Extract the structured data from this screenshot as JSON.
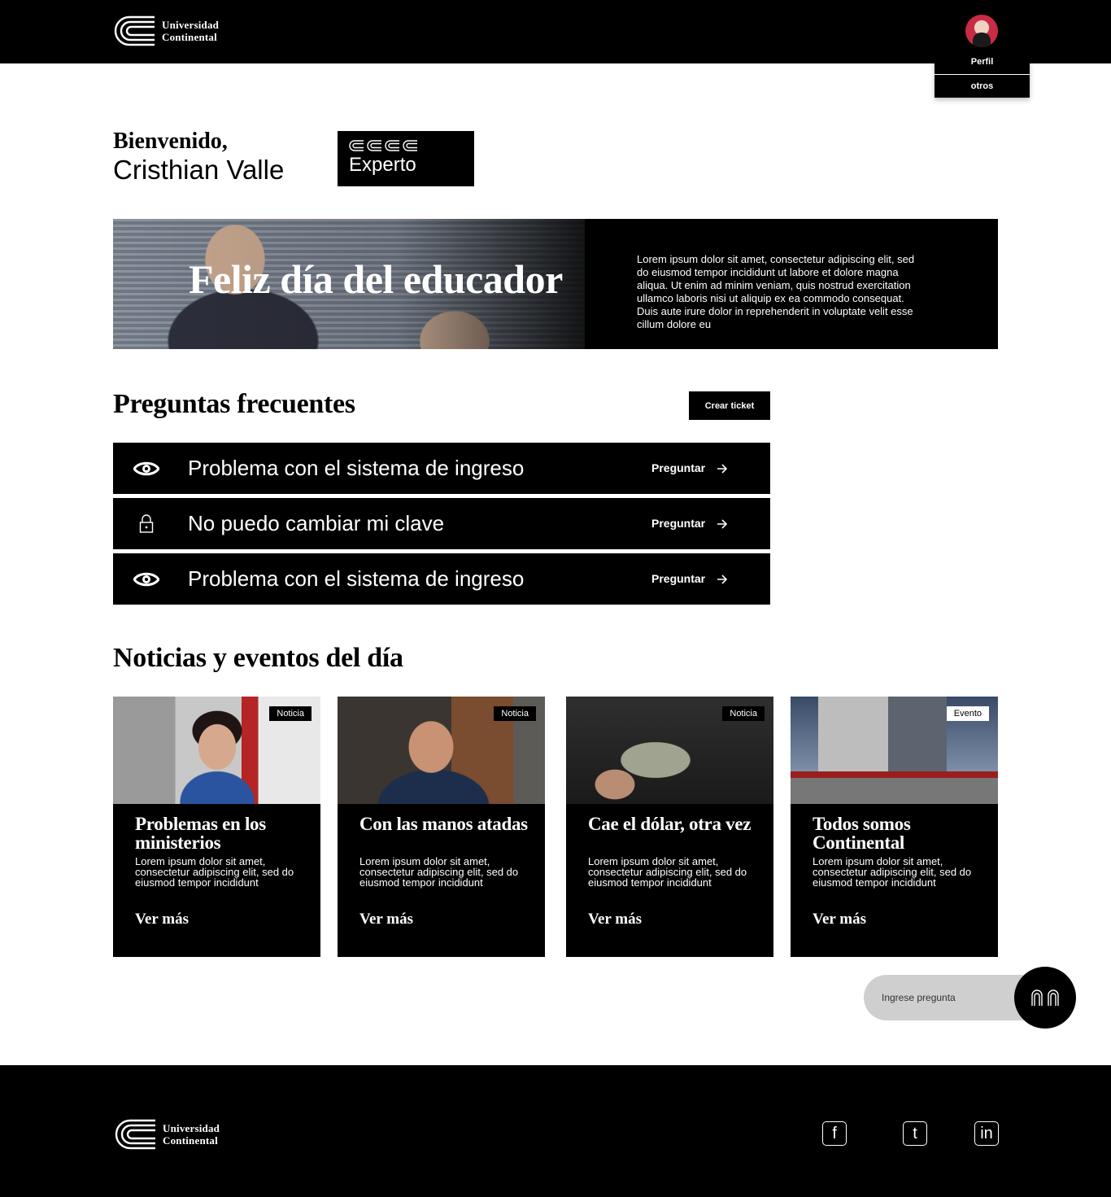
{
  "header": {
    "logo_line1": "Universidad",
    "logo_line2": "Continental",
    "profile_label": "Perfil",
    "profile_other": "otros"
  },
  "welcome": {
    "greeting": "Bienvenido,",
    "name": "Cristhian Valle",
    "level": "Experto"
  },
  "banner": {
    "title": "Feliz día del educador",
    "text": "Lorem ipsum dolor sit amet, consectetur adipiscing elit, sed do eiusmod tempor incididunt ut labore et dolore magna aliqua. Ut enim ad minim veniam, quis nostrud exercitation ullamco laboris nisi ut aliquip ex ea commodo consequat. Duis aute irure dolor in reprehenderit in voluptate velit esse cillum dolore eu"
  },
  "faq": {
    "title": "Preguntas frecuentes",
    "create_ticket": "Crear ticket",
    "items": [
      {
        "icon": "eye-icon",
        "text": "Problema con el sistema de ingreso",
        "action": "Preguntar"
      },
      {
        "icon": "lock-icon",
        "text": "No puedo cambiar mi clave",
        "action": "Preguntar"
      },
      {
        "icon": "eye-icon",
        "text": "Problema con el sistema de ingreso",
        "action": "Preguntar"
      }
    ]
  },
  "news": {
    "title": "Noticias y eventos del día",
    "cards": [
      {
        "tag": "Noticia",
        "title": "Problemas en los ministerios",
        "desc": "Lorem ipsum dolor sit amet, consectetur adipiscing elit, sed do eiusmod tempor incididunt",
        "more": "Ver más"
      },
      {
        "tag": "Noticia",
        "title": "Con las manos atadas",
        "desc": "Lorem ipsum dolor sit amet, consectetur adipiscing elit, sed do eiusmod tempor incididunt",
        "more": "Ver más"
      },
      {
        "tag": "Noticia",
        "title": "Cae el dólar, otra vez",
        "desc": "Lorem ipsum dolor sit amet, consectetur adipiscing elit, sed do eiusmod tempor incididunt",
        "more": "Ver más"
      },
      {
        "tag": "Evento",
        "title": "Todos somos Continental",
        "desc": "Lorem ipsum dolor sit amet, consectetur adipiscing elit, sed do eiusmod tempor incididunt",
        "more": "Ver más"
      }
    ]
  },
  "chat": {
    "placeholder": "Ingrese pregunta"
  },
  "footer": {
    "logo_line1": "Universidad",
    "logo_line2": "Continental",
    "social": [
      "f",
      "t",
      "in"
    ]
  },
  "colors": {
    "primary": "#000000",
    "background": "#ffffff",
    "chat_input_bg": "#cfcfcf"
  }
}
